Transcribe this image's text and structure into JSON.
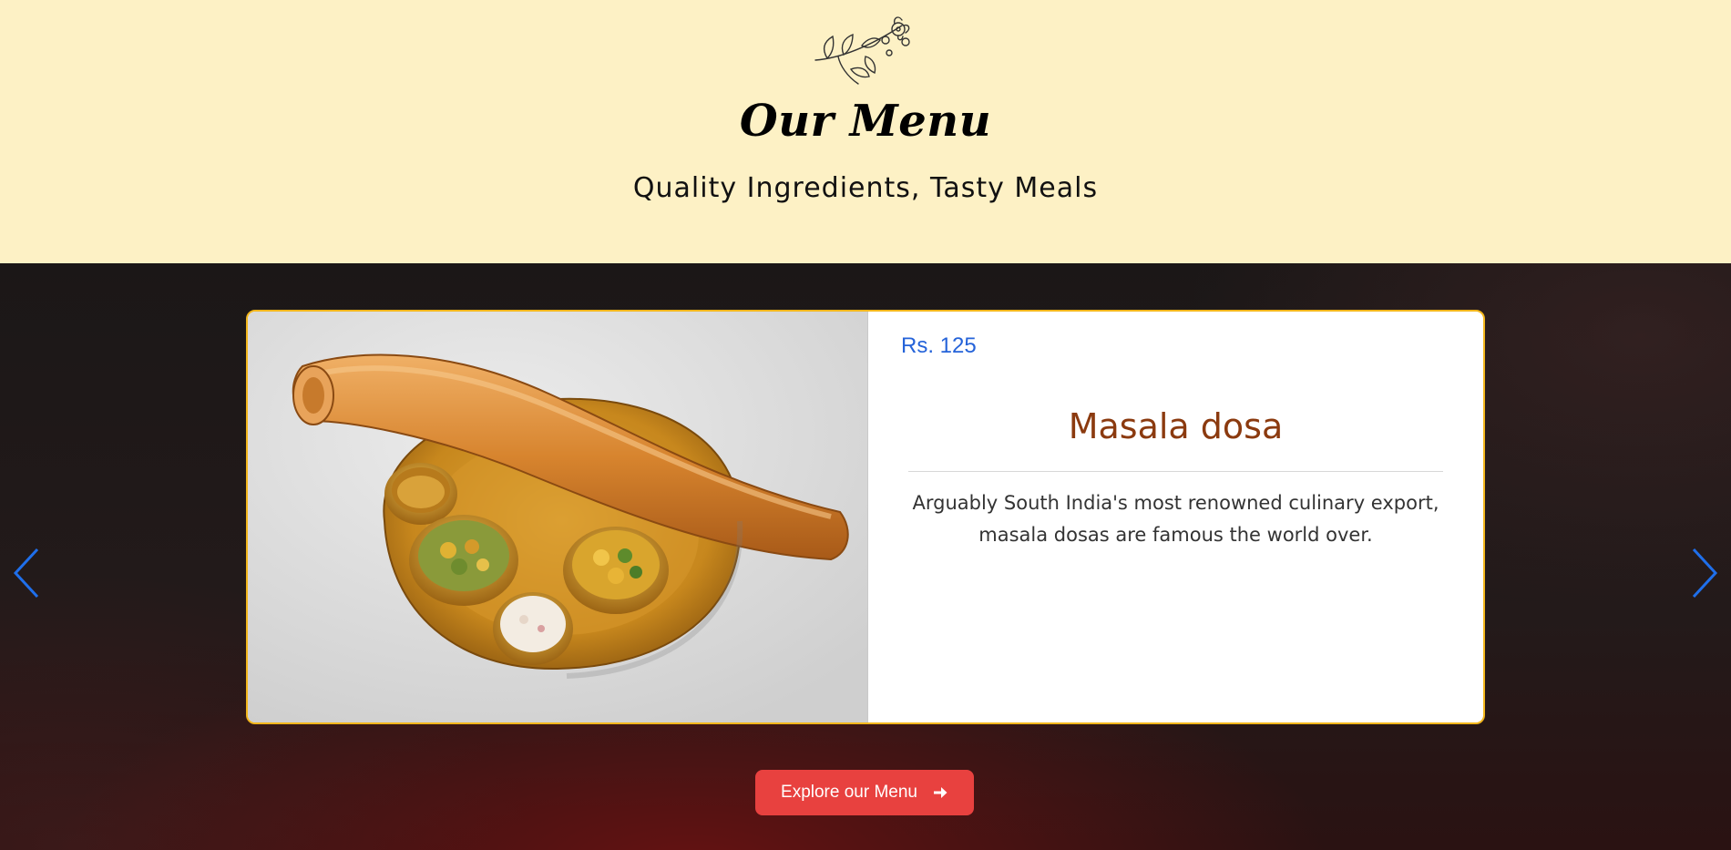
{
  "hero": {
    "title": "Our Menu",
    "subtitle": "Quality Ingredients, Tasty Meals",
    "decoration_icon": "floral-sprig-icon",
    "background": "#fdf1c5"
  },
  "carousel": {
    "prev_icon": "chevron-left-icon",
    "next_icon": "chevron-right-icon",
    "arrow_color": "#1f6feb",
    "active_item": {
      "price": "Rs. 125",
      "name": "Masala dosa",
      "description": "Arguably South India's most renowned culinary export, masala dosas are famous the world over.",
      "image": "masala-dosa-photo"
    }
  },
  "cta": {
    "label": "Explore our Menu",
    "icon": "arrow-right-icon",
    "color": "#e8413f"
  },
  "colors": {
    "card_border": "#f2b61c",
    "price": "#2563d9",
    "dish_name": "#8b3a0f"
  }
}
